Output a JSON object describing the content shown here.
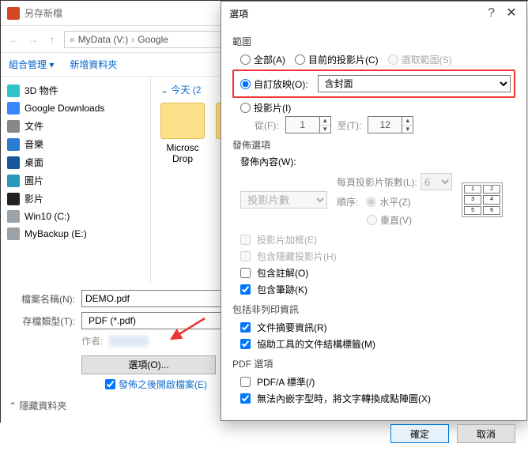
{
  "saveAs": {
    "title": "另存新檔",
    "nav": {
      "back": "←",
      "forward": "→",
      "up": "↑"
    },
    "crumbs": {
      "drive": "MyData (V:)",
      "folder": "Google"
    },
    "organize": "組合管理 ▾",
    "newFolder": "新增資料夾",
    "hideFolders": "隱藏資料夾",
    "today": "今天 (2",
    "fileNameLabel": "檔案名稱(N):",
    "fileName": "DEMO.pdf",
    "fileTypeLabel": "存檔類型(T):",
    "fileType": "PDF (*.pdf)",
    "authorLabel": "作者:",
    "optionsBtn": "選項(O)...",
    "openAfter": "發佈之後開啟檔案(E)",
    "item1_label": "Microsc",
    "item2_label": "Drop"
  },
  "tree": {
    "items": [
      {
        "label": "3D 物件",
        "icon": "cyan"
      },
      {
        "label": "Google Downloads",
        "icon": "blue"
      },
      {
        "label": "文件",
        "icon": "gray"
      },
      {
        "label": "音樂",
        "icon": "note"
      },
      {
        "label": "桌面",
        "icon": "desk"
      },
      {
        "label": "圖片",
        "icon": "pic"
      },
      {
        "label": "影片",
        "icon": "vid"
      },
      {
        "label": "Win10 (C:)",
        "icon": "drive"
      },
      {
        "label": "MyBackup (E:)",
        "icon": "drive"
      }
    ]
  },
  "options": {
    "title": "選項",
    "help": "?",
    "close": "✕",
    "range": {
      "title": "範圍",
      "all": "全部(A)",
      "current": "目前的投影片(C)",
      "selection": "選取範圍(S)",
      "custom": "自訂放映(O):",
      "customValue": "含封面",
      "slides": "投影片(I)",
      "fromLabel": "從(F):",
      "from": "1",
      "toLabel": "至(T):",
      "to": "12"
    },
    "publish": {
      "title": "發佈選項",
      "contentLabel": "發佈內容(W):",
      "content": "投影片數",
      "perPageLabel": "每頁投影片張數(L):",
      "perPage": "6",
      "frame": "投影片加框(E)",
      "hidden": "包含隱藏投影片(H)",
      "comments": "包含註解(O)",
      "ink": "包含筆跡(K)",
      "orderLabel": "順序:",
      "horizontal": "水平(Z)",
      "vertical": "垂直(V)"
    },
    "nonPrint": {
      "title": "包括非列印資訊",
      "docProps": "文件摘要資訊(R)",
      "accessibility": "協助工具的文件結構標籤(M)"
    },
    "pdf": {
      "title": "PDF 選項",
      "pdfa": "PDF/A 標準(/)",
      "bitmapFonts": "無法內嵌字型時，將文字轉換成點陣圖(X)"
    },
    "ok": "確定",
    "cancel": "取消",
    "preview": [
      "1",
      "2",
      "3",
      "4",
      "5",
      "6"
    ]
  }
}
